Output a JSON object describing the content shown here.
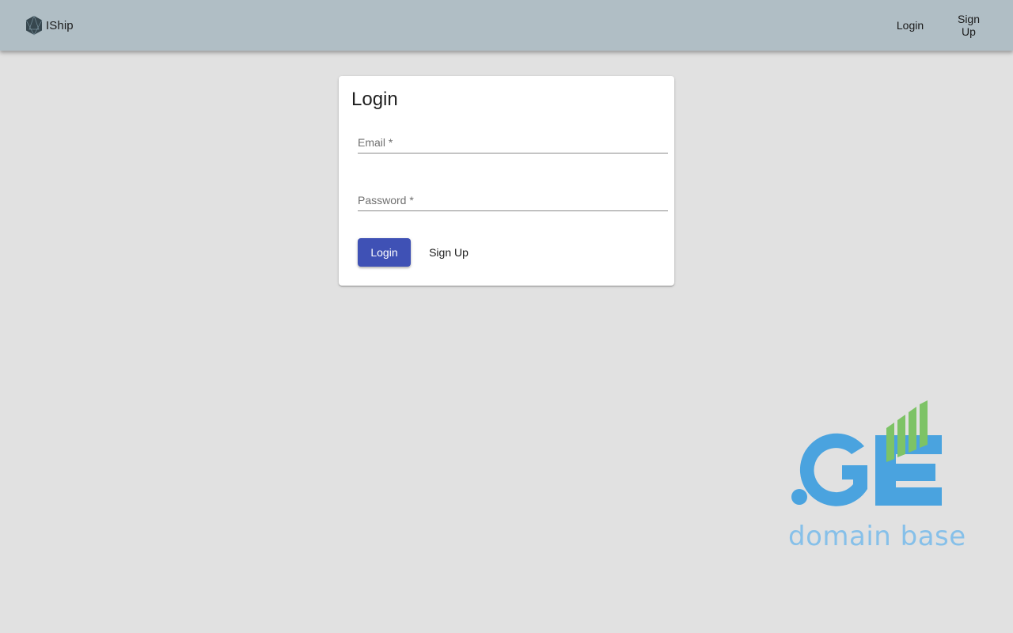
{
  "header": {
    "brand_name": "IShip",
    "nav": {
      "login_label": "Login",
      "signup_label": "Sign Up"
    }
  },
  "login_card": {
    "title": "Login",
    "email_label": "Email *",
    "email_value": "",
    "password_label": "Password *",
    "password_value": "",
    "login_button_label": "Login",
    "signup_button_label": "Sign Up"
  },
  "watermark": {
    "logo_text": ".GE",
    "tagline": "domain base"
  },
  "colors": {
    "appbar": "#b0bec5",
    "background": "#e1e1e1",
    "primary": "#3f51b5",
    "watermark_blue": "#4aa3df",
    "watermark_green": "#7dc366"
  },
  "icons": {
    "brand": "hexagon-logo-icon"
  }
}
